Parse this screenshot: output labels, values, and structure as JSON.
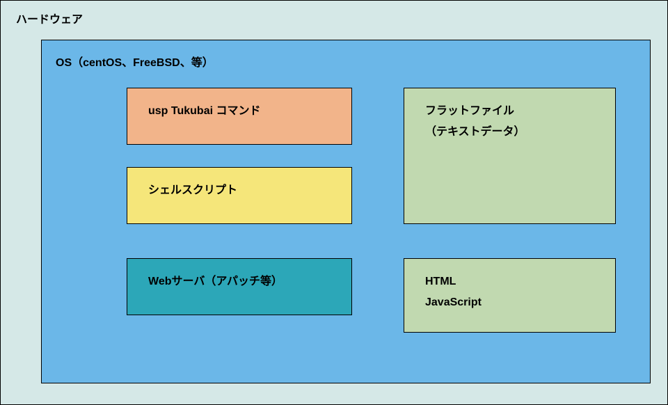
{
  "outer": {
    "label": "ハードウェア"
  },
  "inner": {
    "label": "OS（centOS、FreeBSD、等）"
  },
  "boxes": {
    "tukubai": {
      "label": "usp Tukubai コマンド"
    },
    "shell": {
      "label": "シェルスクリプト"
    },
    "web": {
      "label": "Webサーバ（アパッチ等）"
    },
    "flat": {
      "line1": "フラットファイル",
      "line2": "（テキストデータ）"
    },
    "html": {
      "line1": "HTML",
      "line2": "JavaScript"
    }
  },
  "colors": {
    "outer_bg": "#d5e8e7",
    "inner_bg": "#6bb7e8",
    "orange": "#f2b48a",
    "yellow": "#f5e67a",
    "teal": "#2ca7b8",
    "green": "#c1d9b0"
  }
}
